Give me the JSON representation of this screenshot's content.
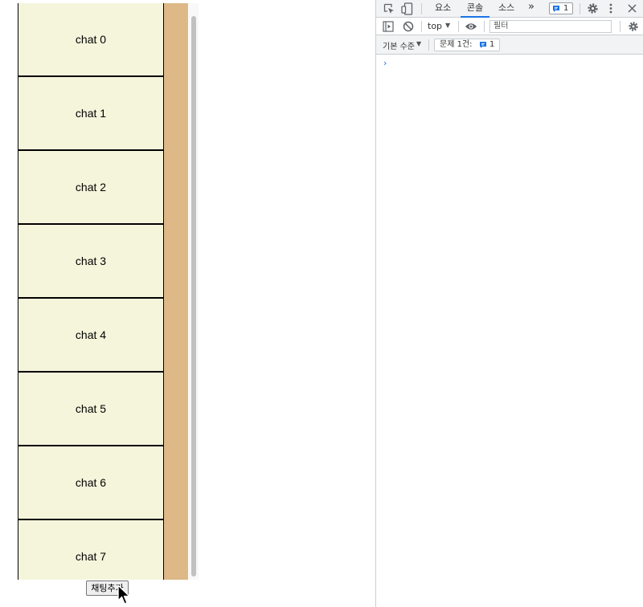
{
  "page": {
    "chats": [
      "chat 0",
      "chat 1",
      "chat 2",
      "chat 3",
      "chat 4",
      "chat 5",
      "chat 6",
      "chat 7"
    ],
    "add_button_label": "채팅추가"
  },
  "devtools": {
    "tabs": [
      "요소",
      "콘솔",
      "소스"
    ],
    "active_tab": "콘솔",
    "more_tabs_label": "»",
    "message_badge_count": "1",
    "context_label": "top",
    "filter_placeholder": "필터",
    "log_level_label": "기본 수준",
    "issues_label": "문제 1건:",
    "issues_count": "1",
    "prompt_symbol": "›"
  },
  "colors": {
    "chat_bg": "#f5f5dc",
    "strip": "#deb887",
    "accent": "#1a73e8"
  }
}
